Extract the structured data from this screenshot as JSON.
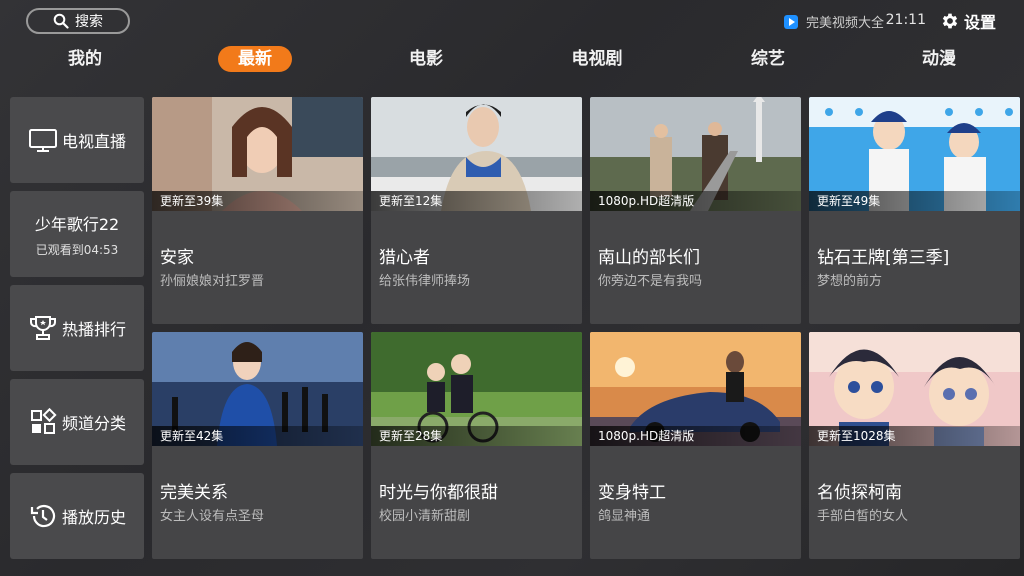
{
  "search": {
    "label": "搜索",
    "icon": "search-icon"
  },
  "header": {
    "brand": "完美视频大全",
    "time": "21:11",
    "settings_label": "设置"
  },
  "tabs": [
    {
      "label": "我的"
    },
    {
      "label": "最新"
    },
    {
      "label": "电影"
    },
    {
      "label": "电视剧"
    },
    {
      "label": "综艺"
    },
    {
      "label": "动漫"
    }
  ],
  "active_tab": "最新",
  "accent_color": "#f27a1a",
  "sidebar": {
    "live": {
      "label": "电视直播",
      "icon": "tv-icon"
    },
    "recent": {
      "title": "少年歌行22",
      "sub": "已观看到04:53"
    },
    "ranking": {
      "label": "热播排行",
      "icon": "trophy-icon"
    },
    "category": {
      "label": "频道分类",
      "icon": "category-grid-icon"
    },
    "history": {
      "label": "播放历史",
      "icon": "history-icon"
    }
  },
  "cards": [
    {
      "badge": "更新至39集",
      "title": "安家",
      "sub": "孙俪娘娘对扛罗晋"
    },
    {
      "badge": "更新至12集",
      "title": "猎心者",
      "sub": "给张伟律师捧场"
    },
    {
      "badge": "1080p.HD超清版",
      "title": "南山的部长们",
      "sub": "你旁边不是有我吗"
    },
    {
      "badge": "更新至49集",
      "title": "钻石王牌[第三季]",
      "sub": "梦想的前方"
    },
    {
      "badge": "更新至42集",
      "title": "完美关系",
      "sub": "女主人设有点圣母"
    },
    {
      "badge": "更新至28集",
      "title": "时光与你都很甜",
      "sub": "校园小清新甜剧"
    },
    {
      "badge": "1080p.HD超清版",
      "title": "变身特工",
      "sub": "鸽显神通"
    },
    {
      "badge": "更新至1028集",
      "title": "名侦探柯南",
      "sub": "手部白皙的女人"
    }
  ]
}
